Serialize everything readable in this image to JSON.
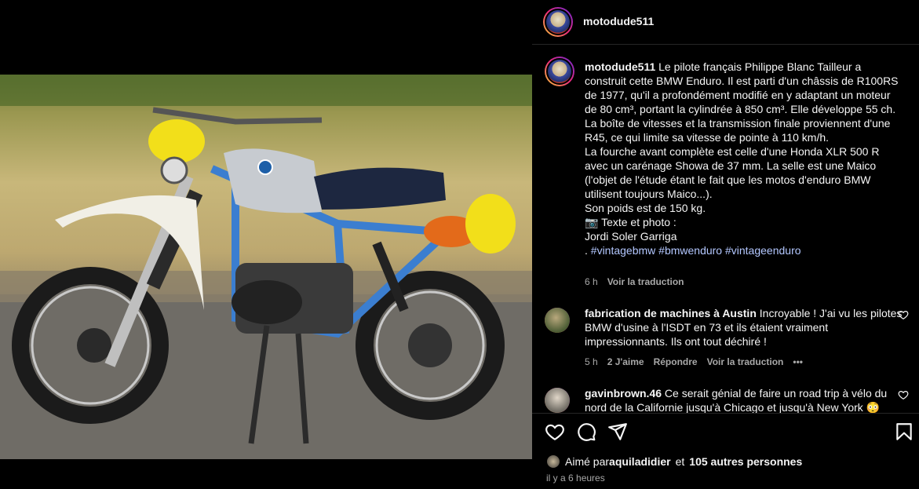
{
  "post": {
    "username": "motodude511",
    "media_alt": "BMW Enduro motorcycle photo"
  },
  "caption": {
    "username": "motodude511",
    "text": "Le pilote français Philippe Blanc Tailleur a construit cette BMW Enduro. Il est parti d'un châssis de R100RS de 1977, qu'il a profondément modifié en y adaptant un moteur de 80 cm³, portant la cylindrée à 850 cm³. Elle développe 55 ch. La boîte de vitesses et la transmission finale proviennent d'une R45, ce qui limite sa vitesse de pointe à 110 km/h.\nLa fourche avant complète est celle d'une Honda XLR 500 R avec un carénage Showa de 37 mm. La selle est une Maico (l'objet de l'étude étant le fait que les motos d'enduro BMW utilisent toujours Maico...).\nSon poids est de 150 kg.\n📷 Texte et photo :\nJordi Soler Garriga",
    "hashtags_prefix": ".",
    "hashtags": "#vintagebmw #bmwenduro #vintageenduro",
    "time": "6 h",
    "translate": "Voir la traduction"
  },
  "comments": [
    {
      "username": "fabrication de machines à Austin",
      "text": "Incroyable ! J'ai vu les pilotes BMW d'usine à l'ISDT en 73 et ils étaient vraiment impressionnants. Ils ont tout déchiré !",
      "time": "5 h",
      "likes": "2 J'aime",
      "reply": "Répondre",
      "translate": "Voir la traduction",
      "more": "•••"
    },
    {
      "username": "gavinbrown.46",
      "text": "Ce serait génial de faire un road trip à vélo du nord de la Californie jusqu'à Chicago et jusqu'à New York 😳"
    }
  ],
  "likes": {
    "prefix": "Aimé par",
    "user": "aquiladidier",
    "conj": "et",
    "others": "105 autres personnes"
  },
  "timestamp": "il y a 6 heures",
  "icons": [
    "heart-icon",
    "comment-icon",
    "share-icon",
    "bookmark-icon"
  ],
  "colors": {
    "background": "#000000",
    "hashtag": "#b3c7ff",
    "muted": "#a8a8a8",
    "text": "#f5f5f5"
  }
}
